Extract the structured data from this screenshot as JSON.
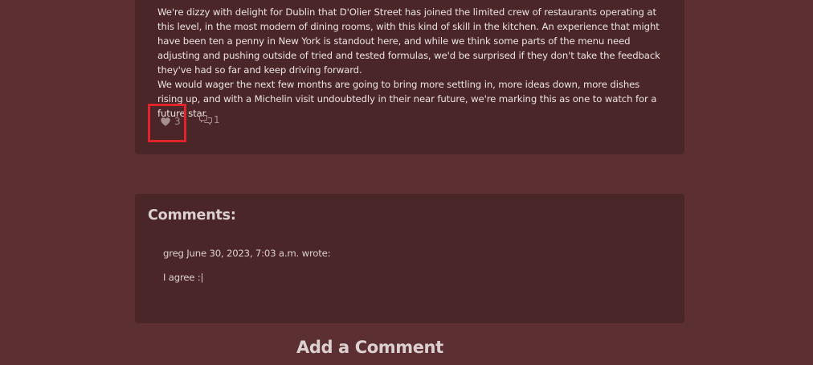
{
  "post": {
    "paragraphs": [
      "We're dizzy with delight for Dublin that D'Olier Street has joined the limited crew of restaurants operating at this level, in the most modern of dining rooms, with this kind of skill in the kitchen. An experience that might have been ten a penny in New York is standout here, and while we think some parts of the menu need adjusting and pushing outside of tried and tested formulas, we'd be surprised if they don't take the feedback they've had so far and keep driving forward.",
      "We would wager the next few months are going to bring more settling in, more ideas down, more dishes rising up, and with a Michelin visit undoubtedly in their near future, we're marking this as one to watch for a future star."
    ],
    "likes": "3",
    "comments": "1",
    "like_icon": "heart-icon",
    "comment_icon": "comments-icon",
    "highlight_color": "#e0242b"
  },
  "comments_section": {
    "title": "Comments:",
    "items": [
      {
        "meta": "greg June 30, 2023, 7:03 a.m. wrote:",
        "text": "I agree :|"
      }
    ]
  },
  "add_comment": {
    "title": "Add a Comment"
  }
}
